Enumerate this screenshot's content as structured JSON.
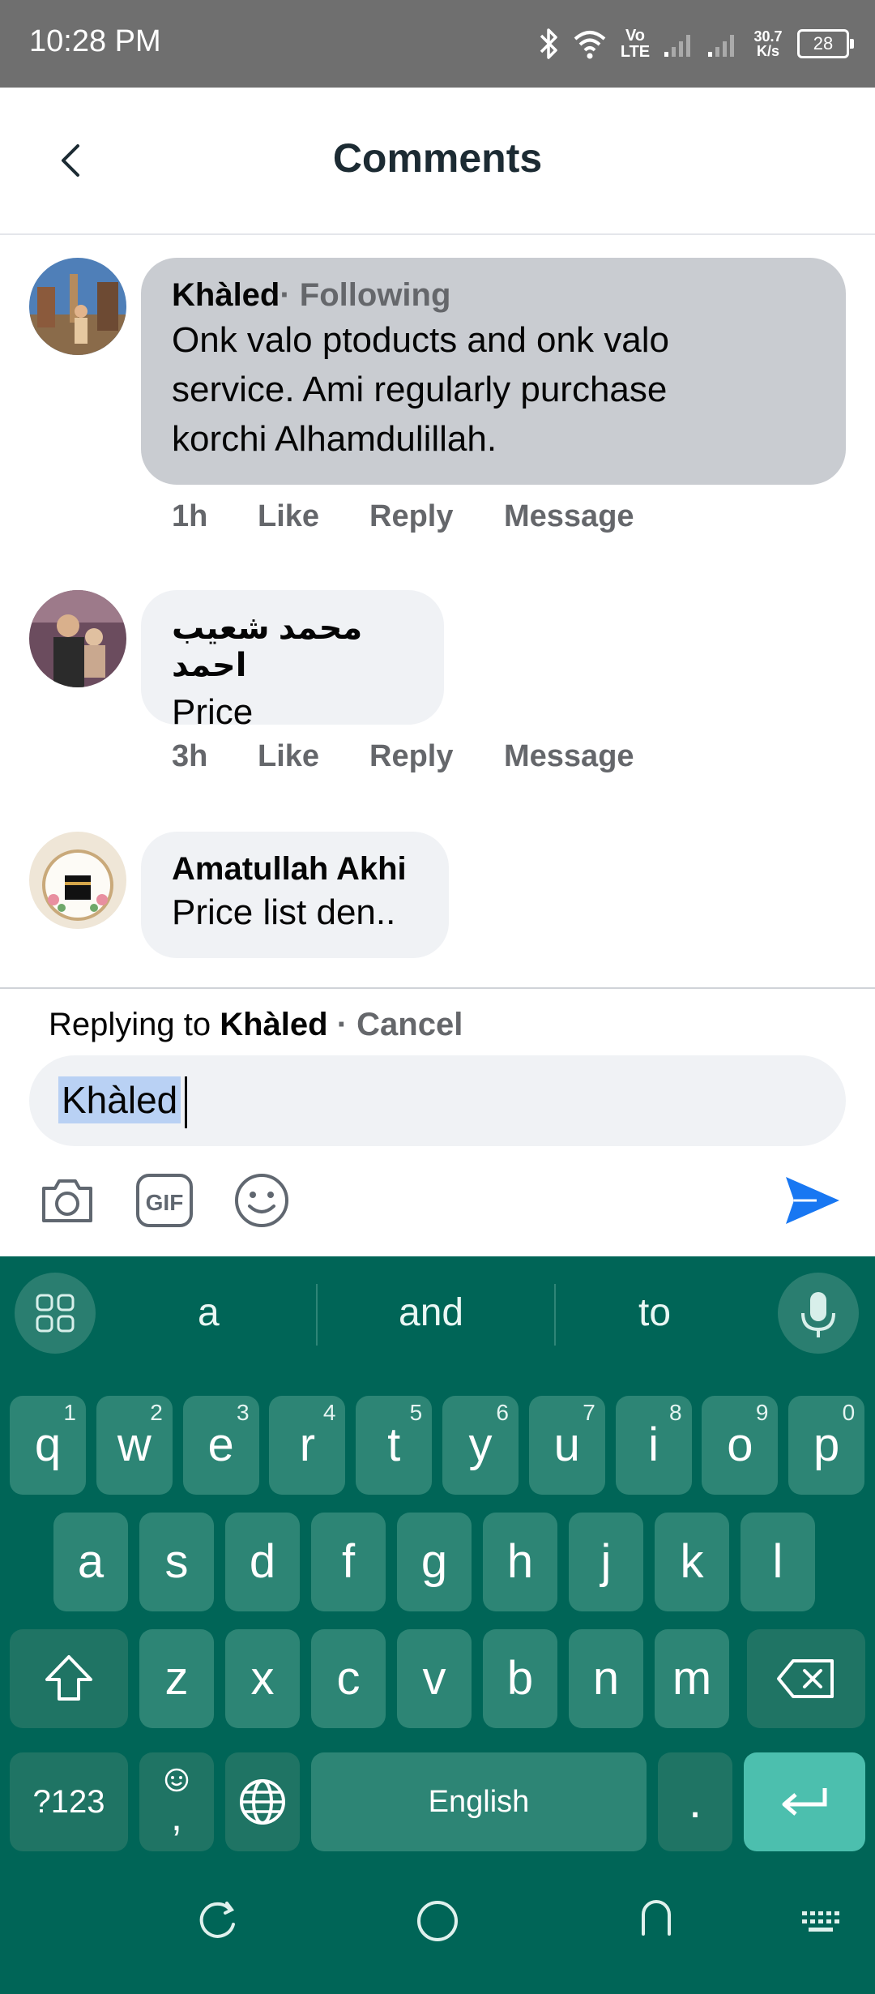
{
  "status_bar": {
    "time": "10:28 PM",
    "network_label": "Vo LTE",
    "speed_value": "30.7",
    "speed_unit": "K/s",
    "battery": "28"
  },
  "header": {
    "title": "Comments"
  },
  "comments": [
    {
      "author": "Khàled",
      "follow_label": "· Following",
      "lines": [
        "Onk valo ptoducts and onk valo",
        "service. Ami regularly purchase",
        "korchi Alhamdulillah."
      ],
      "time": "1h",
      "like": "Like",
      "reply": "Reply",
      "message": "Message"
    },
    {
      "author": "محمد شعیب احمد",
      "lines": [
        "Price"
      ],
      "time": "3h",
      "like": "Like",
      "reply": "Reply",
      "message": "Message"
    },
    {
      "author": "Amatullah Akhi",
      "lines": [
        "Price list den.."
      ]
    }
  ],
  "composer": {
    "replying_prefix": "Replying to ",
    "replying_name": "Khàled",
    "separator": " · ",
    "cancel": "Cancel",
    "input_value": "Khàled"
  },
  "keyboard": {
    "suggestions": [
      "a",
      "and",
      "to"
    ],
    "row1": [
      {
        "k": "q",
        "h": "1"
      },
      {
        "k": "w",
        "h": "2"
      },
      {
        "k": "e",
        "h": "3"
      },
      {
        "k": "r",
        "h": "4"
      },
      {
        "k": "t",
        "h": "5"
      },
      {
        "k": "y",
        "h": "6"
      },
      {
        "k": "u",
        "h": "7"
      },
      {
        "k": "i",
        "h": "8"
      },
      {
        "k": "o",
        "h": "9"
      },
      {
        "k": "p",
        "h": "0"
      }
    ],
    "row2": [
      "a",
      "s",
      "d",
      "f",
      "g",
      "h",
      "j",
      "k",
      "l"
    ],
    "row3": [
      "z",
      "x",
      "c",
      "v",
      "b",
      "n",
      "m"
    ],
    "symbols_key": "?123",
    "comma_key": ",",
    "space_label": "English",
    "period_key": "."
  },
  "colors": {
    "keyboard_bg": "#006557",
    "key_bg": "#2d8575",
    "enter_key": "#4cbfae",
    "send_icon": "#1877f2"
  }
}
